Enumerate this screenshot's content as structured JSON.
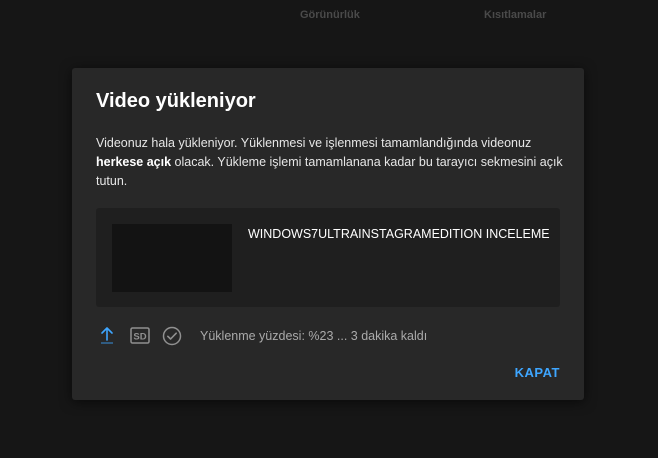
{
  "background": {
    "columns": [
      "Görünürlük",
      "Kısıtlamalar"
    ]
  },
  "dialog": {
    "title": "Video yükleniyor",
    "body_part1": "Videonuz hala yükleniyor. Yüklenmesi ve işlenmesi tamamlandığında videonuz ",
    "body_bold": "herkese açık",
    "body_part2": " olacak. Yükleme işlemi tamamlanana kadar bu tarayıcı sekmesini açık tutun.",
    "video": {
      "title": "WINDOWS7ULTRAINSTAGRAMEDITION INCELEME"
    },
    "status": {
      "icons": [
        "upload-icon",
        "sd-icon",
        "check-circle-icon"
      ],
      "text": "Yüklenme yüzdesi: %23 ... 3 dakika kaldı",
      "upload_percent": 23
    },
    "close_label": "KAPAT"
  },
  "colors": {
    "accent": "#3ea6ff",
    "dialog_bg": "#282828",
    "page_bg": "#161616"
  }
}
